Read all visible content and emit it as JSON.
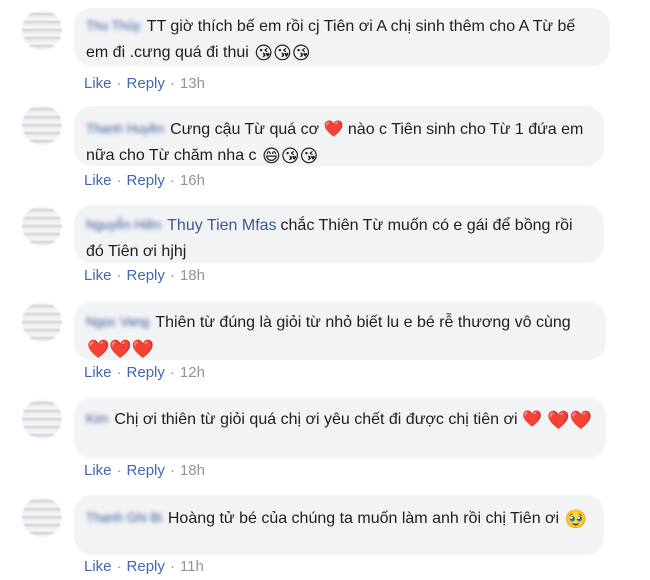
{
  "comments": [
    {
      "name": "Thu Thủy",
      "text": "TT giờ thích bế em rồi cj Tiên ơi A chị sinh thêm cho A Từ bế em đi .cưng quá đi thui",
      "emoji": "😘😘😘",
      "like": "Like",
      "reply": "Reply",
      "time": "13h"
    },
    {
      "name": "Thanh Huyền",
      "text": "Cưng cậu Từ quá cơ ❤️ nào c Tiên sinh cho Từ 1 đứa em nữa cho Từ chăm nha c",
      "emoji": "😄😘😘",
      "like": "Like",
      "reply": "Reply",
      "time": "16h"
    },
    {
      "name": "Nguyễn Hiền",
      "tag": "Thuy Tien Mfas",
      "text": "chắc Thiên Từ muốn có e gái để bồng rồi đó Tiên ơi hjhj",
      "emoji": "",
      "like": "Like",
      "reply": "Reply",
      "time": "18h"
    },
    {
      "name": "Ngọc Vang",
      "text": "Thiên từ đúng là giỏi từ nhỏ biết lu e bé rễ thương vô cùng",
      "emoji": "❤️❤️❤️",
      "like": "Like",
      "reply": "Reply",
      "time": "12h"
    },
    {
      "name": "Kim",
      "text": "Chị ơi thiên từ giỏi quá chị ơi yêu chết đi được chị tiên ơi ❤️",
      "emoji": "❤️❤️",
      "like": "Like",
      "reply": "Reply",
      "time": "18h"
    },
    {
      "name": "Thanh Ghi Bi",
      "text": "Hoàng tử bé của chúng ta muốn làm anh rồi chị Tiên ơi",
      "emoji": "🥹",
      "like": "Like",
      "reply": "Reply",
      "time": "11h"
    }
  ]
}
